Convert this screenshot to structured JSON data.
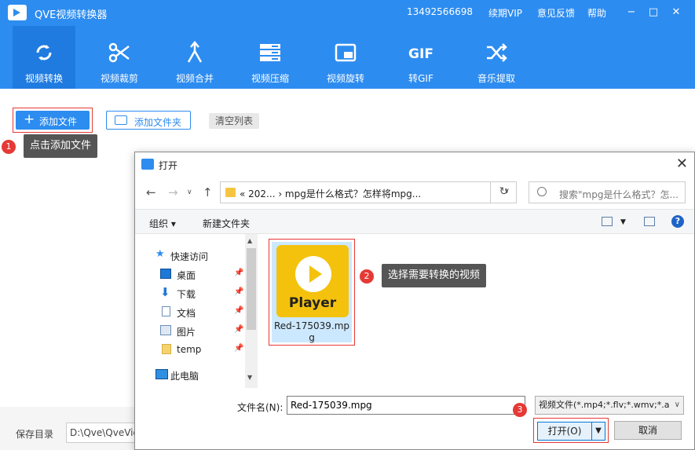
{
  "app": {
    "title": "QVE视频转换器",
    "phone": "13492566698",
    "vip": "续期VIP",
    "feedback": "意见反馈",
    "help": "帮助"
  },
  "window_controls": {
    "minimize": "−",
    "maximize": "□",
    "close": "✕"
  },
  "toolbar": {
    "items": [
      {
        "label": "视频转换",
        "icon": "refresh-icon",
        "active": true
      },
      {
        "label": "视频裁剪",
        "icon": "scissors-icon"
      },
      {
        "label": "视频合并",
        "icon": "merge-icon"
      },
      {
        "label": "视频压缩",
        "icon": "compress-icon"
      },
      {
        "label": "视频旋转",
        "icon": "rotate-icon"
      },
      {
        "label": "转GIF",
        "icon": "gif-icon",
        "icon_text": "GIF"
      },
      {
        "label": "音乐提取",
        "icon": "shuffle-icon"
      }
    ]
  },
  "main": {
    "add_file": "添加文件",
    "add_folder": "添加文件夹",
    "clear_list": "清空列表",
    "save_dir_label": "保存目录",
    "save_dir_value": "D:\\Qve\\QveVid"
  },
  "annotations": {
    "step1": {
      "num": "1",
      "text": "点击添加文件"
    },
    "step2": {
      "num": "2",
      "text": "选择需要转换的视频"
    },
    "step3": {
      "num": "3"
    }
  },
  "dialog": {
    "title": "打开",
    "address": "«  202...  ›  mpg是什么格式？怎样将mpg...",
    "search_placeholder": "搜索\"mpg是什么格式？怎...",
    "organize": "组织 ▾",
    "new_folder": "新建文件夹",
    "nav": [
      {
        "label": "快速访问",
        "icon": "star-icon"
      },
      {
        "label": "桌面",
        "icon": "desktop-icon",
        "pinned": true
      },
      {
        "label": "下载",
        "icon": "download-icon",
        "pinned": true
      },
      {
        "label": "文档",
        "icon": "document-icon",
        "pinned": true
      },
      {
        "label": "图片",
        "icon": "picture-icon",
        "pinned": true
      },
      {
        "label": "temp",
        "icon": "folder-icon",
        "pinned": true
      },
      {
        "label": "此电脑",
        "icon": "computer-icon"
      }
    ],
    "file": {
      "thumb_text": "Player",
      "name": "Red-175039.mpg"
    },
    "filename_label": "文件名(N):",
    "filename_value": "Red-175039.mpg",
    "filetype": "视频文件(*.mp4;*.flv;*.wmv;*.a",
    "open_btn": "打开(O)",
    "cancel_btn": "取消"
  },
  "colors": {
    "brand": "#2d8cf0",
    "annotation": "#e53935",
    "player": "#f4c20d"
  }
}
